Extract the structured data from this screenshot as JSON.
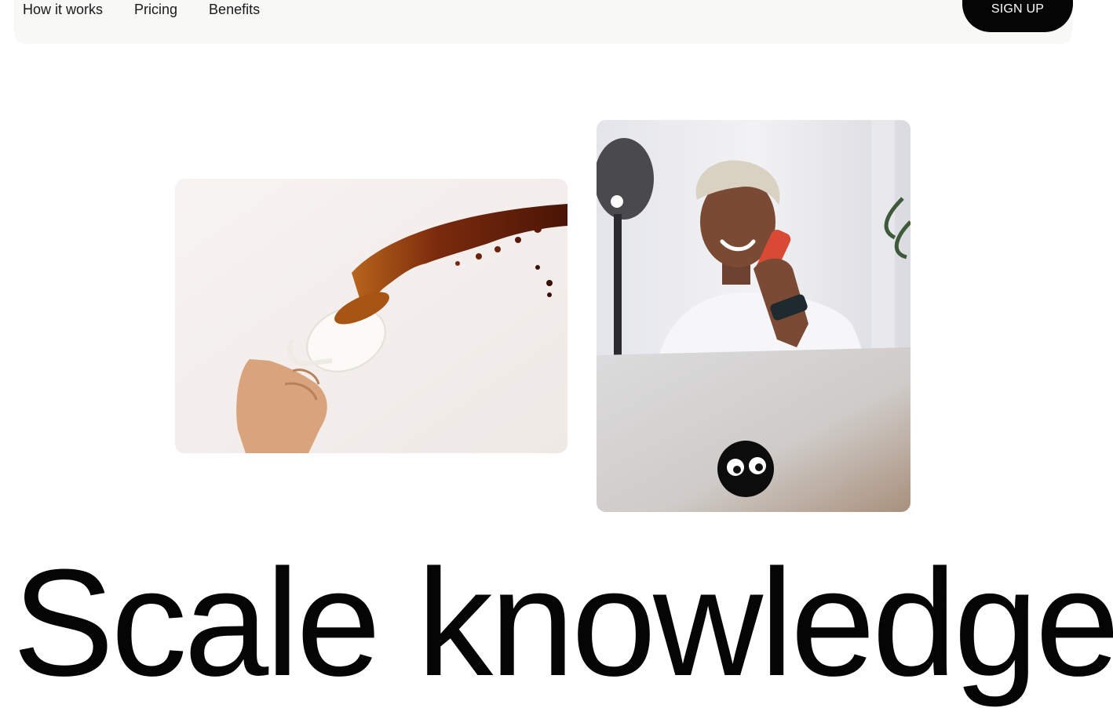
{
  "nav": {
    "links": [
      "How it works",
      "Pricing",
      "Benefits"
    ],
    "signup_label": "SIGN UP"
  },
  "hero": {
    "headline": "Scale knowledge",
    "images": [
      {
        "subject": "hand-spilling-coffee-cup"
      },
      {
        "subject": "smiling-man-on-phone-with-laptop"
      }
    ]
  },
  "colors": {
    "nav_bg": "#f8f8f7",
    "button_bg": "#050505",
    "button_text": "#ffffff",
    "text": "#111111",
    "coffee": "#5a1f08"
  }
}
